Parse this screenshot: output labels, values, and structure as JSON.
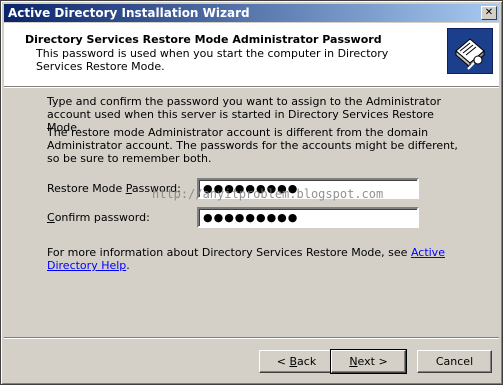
{
  "window": {
    "title": "Active Directory Installation Wizard",
    "close_glyph": "✕"
  },
  "header": {
    "title": "Directory Services Restore Mode Administrator Password",
    "subtitle": "This password is used when you start the computer in Directory Services Restore Mode."
  },
  "body": {
    "para1": "Type and confirm the password you want to assign to the Administrator account used when this server is started in Directory Services Restore Mode.",
    "para2": "The restore mode Administrator account is different from the domain Administrator account. The passwords for the accounts might be different, so be sure to remember both.",
    "password_label_pre": "Restore Mode ",
    "password_label_accel": "P",
    "password_label_post": "assword:",
    "password_value": "●●●●●●●●●",
    "confirm_label_accel": "C",
    "confirm_label_post": "onfirm password:",
    "confirm_value": "●●●●●●●●●",
    "watermark": "http://anyitproblem.blogspot.com",
    "help_text": "For more information about Directory Services Restore Mode, see ",
    "help_link": "Active Directory Help",
    "help_end": "."
  },
  "buttons": {
    "back_prefix": "< ",
    "back_accel": "B",
    "back_rest": "ack",
    "next_accel": "N",
    "next_rest": "ext >",
    "cancel": "Cancel"
  },
  "colors": {
    "titlebar_start": "#0a246a",
    "titlebar_end": "#a6caf0",
    "link": "#0000ff"
  }
}
